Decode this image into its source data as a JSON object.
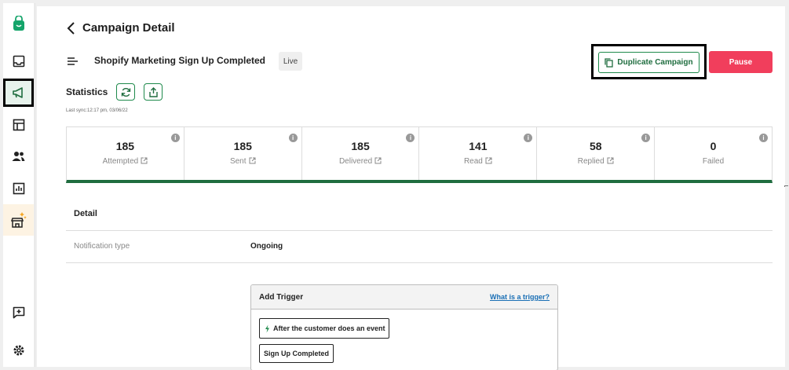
{
  "header": {
    "title": "Campaign Detail"
  },
  "campaign": {
    "name": "Shopify Marketing Sign Up Completed",
    "status": "Live"
  },
  "actions": {
    "duplicate_label": "Duplicate Campaign",
    "pause_label": "Pause"
  },
  "statistics": {
    "title": "Statistics",
    "last_sync": "Last sync:12:17 pm, 03/06/22",
    "items": [
      {
        "value": "185",
        "label": "Attempted"
      },
      {
        "value": "185",
        "label": "Sent"
      },
      {
        "value": "185",
        "label": "Delivered"
      },
      {
        "value": "141",
        "label": "Read"
      },
      {
        "value": "58",
        "label": "Replied"
      },
      {
        "value": "0",
        "label": "Failed"
      }
    ]
  },
  "detail": {
    "title": "Detail",
    "rows": [
      {
        "key": "Notification type",
        "value": "Ongoing"
      }
    ]
  },
  "trigger": {
    "title": "Add Trigger",
    "help_link": "What is a trigger?",
    "event_button": "After the customer does an event",
    "event_name": "Sign Up Completed"
  },
  "icons": {
    "sidebar": [
      "bag-logo-icon",
      "inbox-icon",
      "megaphone-icon",
      "table-icon",
      "people-icon",
      "chart-icon",
      "marketplace-icon",
      "feedback-icon",
      "gear-icon"
    ]
  },
  "colors": {
    "primary": "#1f6d3f",
    "danger": "#f13e5c",
    "link": "#1a6fb5"
  }
}
